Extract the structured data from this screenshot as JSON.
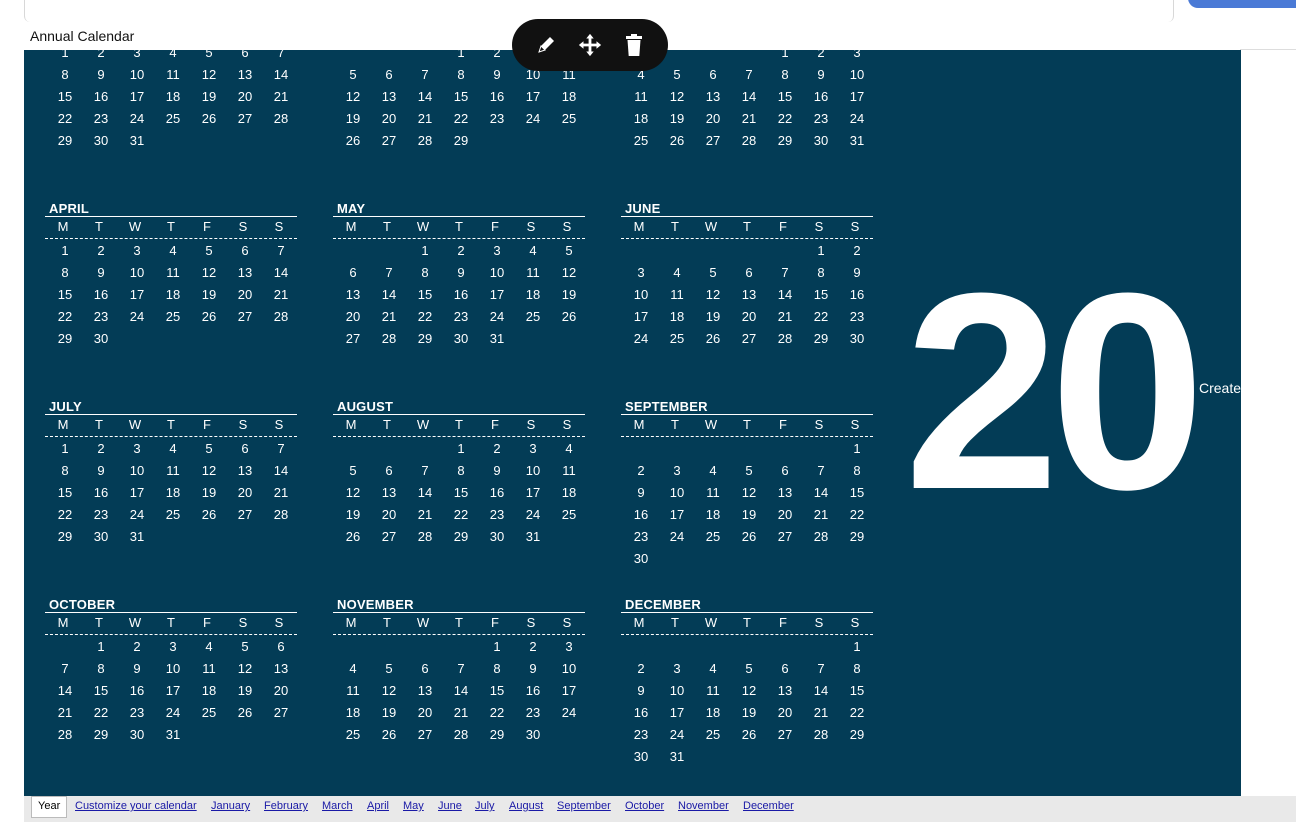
{
  "page": {
    "title": "Annual Calendar"
  },
  "weekdays": [
    "M",
    "T",
    "W",
    "T",
    "F",
    "S",
    "S"
  ],
  "months": [
    {
      "name": "",
      "lead": 0,
      "days": 31,
      "visible_from_row": 0
    },
    {
      "name": "",
      "lead": 3,
      "days": 29
    },
    {
      "name": "",
      "lead": 4,
      "days": 31
    },
    {
      "name": "APRIL",
      "lead": 0,
      "days": 30
    },
    {
      "name": "MAY",
      "lead": 2,
      "days": 31
    },
    {
      "name": "JUNE",
      "lead": 5,
      "days": 30
    },
    {
      "name": "JULY",
      "lead": 0,
      "days": 31
    },
    {
      "name": "AUGUST",
      "lead": 3,
      "days": 31
    },
    {
      "name": "SEPTEMBER",
      "lead": 6,
      "days": 30
    },
    {
      "name": "OCTOBER",
      "lead": 1,
      "days": 31
    },
    {
      "name": "NOVEMBER",
      "lead": 4,
      "days": 30
    },
    {
      "name": "DECEMBER",
      "lead": 6,
      "days": 31
    }
  ],
  "big_year": "20",
  "side_label": "Create",
  "toolbar": {
    "icons": [
      "pencil-icon",
      "move-icon",
      "trash-icon"
    ]
  },
  "bottom_bar": {
    "year_tab": "Year",
    "links": [
      "Customize your calendar",
      "January",
      "February",
      "March",
      "April",
      "May",
      "June",
      "July",
      "August",
      "September",
      "October",
      "November",
      "December"
    ]
  },
  "colors": {
    "canvas": "#033c56",
    "text": "#ffffff"
  }
}
